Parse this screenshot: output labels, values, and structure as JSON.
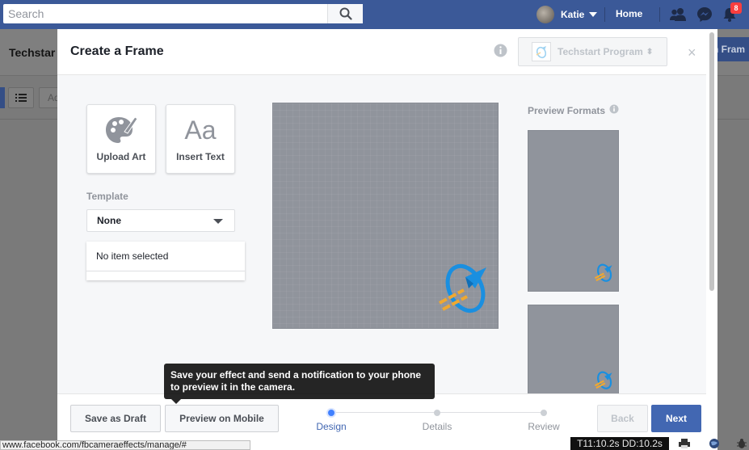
{
  "topbar": {
    "search_placeholder": "Search",
    "user_name": "Katie",
    "home_label": "Home",
    "notification_count": "8",
    "icons": [
      "search-icon",
      "friends-icon",
      "messenger-icon",
      "bell-icon"
    ],
    "brand_color": "#3b5998"
  },
  "background_page": {
    "title": "Techstar",
    "right_button_label": "n Fram",
    "toolbar_button_label": "Ad",
    "status_url": "www.facebook.com/fbcameraeffects/manage/#",
    "timer_text": "T11:10.2s DD:10.2s"
  },
  "modal": {
    "title": "Create a Frame",
    "program_name": "Techstart Program",
    "program_caret": "⬍",
    "close_glyph": "×",
    "tools": [
      {
        "label": "Upload Art",
        "icon": "palette-icon"
      },
      {
        "label": "Insert Text",
        "glyph": "Aa",
        "icon": "text-icon"
      }
    ],
    "template_label": "Template",
    "template_value": "None",
    "layers_empty_text": "No item selected",
    "preview_formats_label": "Preview Formats",
    "footer": {
      "save_draft_label": "Save as Draft",
      "preview_mobile_label": "Preview on Mobile",
      "back_label": "Back",
      "next_label": "Next"
    },
    "steps": [
      {
        "label": "Design",
        "active": true
      },
      {
        "label": "Details",
        "active": false
      },
      {
        "label": "Review",
        "active": false
      }
    ],
    "tooltip_text": "Save your effect and send a notification to your phone to preview it in the camera.",
    "colors": {
      "primary": "#4267b2",
      "step_active": "#4080ff",
      "canvas": "#90949c",
      "logo_blue": "#1a8fe0",
      "logo_orange": "#f0a830"
    }
  }
}
